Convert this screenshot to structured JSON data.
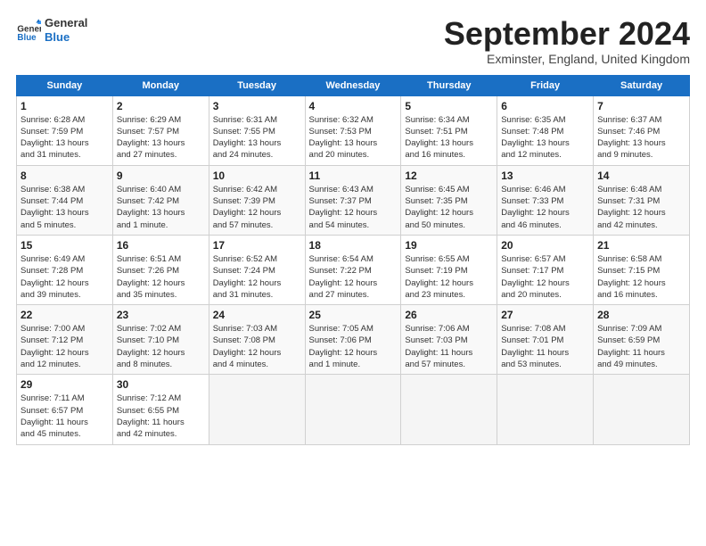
{
  "header": {
    "logo_line1": "General",
    "logo_line2": "Blue",
    "month": "September 2024",
    "location": "Exminster, England, United Kingdom"
  },
  "days_of_week": [
    "Sunday",
    "Monday",
    "Tuesday",
    "Wednesday",
    "Thursday",
    "Friday",
    "Saturday"
  ],
  "weeks": [
    [
      {
        "day": "1",
        "info": "Sunrise: 6:28 AM\nSunset: 7:59 PM\nDaylight: 13 hours\nand 31 minutes."
      },
      {
        "day": "2",
        "info": "Sunrise: 6:29 AM\nSunset: 7:57 PM\nDaylight: 13 hours\nand 27 minutes."
      },
      {
        "day": "3",
        "info": "Sunrise: 6:31 AM\nSunset: 7:55 PM\nDaylight: 13 hours\nand 24 minutes."
      },
      {
        "day": "4",
        "info": "Sunrise: 6:32 AM\nSunset: 7:53 PM\nDaylight: 13 hours\nand 20 minutes."
      },
      {
        "day": "5",
        "info": "Sunrise: 6:34 AM\nSunset: 7:51 PM\nDaylight: 13 hours\nand 16 minutes."
      },
      {
        "day": "6",
        "info": "Sunrise: 6:35 AM\nSunset: 7:48 PM\nDaylight: 13 hours\nand 12 minutes."
      },
      {
        "day": "7",
        "info": "Sunrise: 6:37 AM\nSunset: 7:46 PM\nDaylight: 13 hours\nand 9 minutes."
      }
    ],
    [
      {
        "day": "8",
        "info": "Sunrise: 6:38 AM\nSunset: 7:44 PM\nDaylight: 13 hours\nand 5 minutes."
      },
      {
        "day": "9",
        "info": "Sunrise: 6:40 AM\nSunset: 7:42 PM\nDaylight: 13 hours\nand 1 minute."
      },
      {
        "day": "10",
        "info": "Sunrise: 6:42 AM\nSunset: 7:39 PM\nDaylight: 12 hours\nand 57 minutes."
      },
      {
        "day": "11",
        "info": "Sunrise: 6:43 AM\nSunset: 7:37 PM\nDaylight: 12 hours\nand 54 minutes."
      },
      {
        "day": "12",
        "info": "Sunrise: 6:45 AM\nSunset: 7:35 PM\nDaylight: 12 hours\nand 50 minutes."
      },
      {
        "day": "13",
        "info": "Sunrise: 6:46 AM\nSunset: 7:33 PM\nDaylight: 12 hours\nand 46 minutes."
      },
      {
        "day": "14",
        "info": "Sunrise: 6:48 AM\nSunset: 7:31 PM\nDaylight: 12 hours\nand 42 minutes."
      }
    ],
    [
      {
        "day": "15",
        "info": "Sunrise: 6:49 AM\nSunset: 7:28 PM\nDaylight: 12 hours\nand 39 minutes."
      },
      {
        "day": "16",
        "info": "Sunrise: 6:51 AM\nSunset: 7:26 PM\nDaylight: 12 hours\nand 35 minutes."
      },
      {
        "day": "17",
        "info": "Sunrise: 6:52 AM\nSunset: 7:24 PM\nDaylight: 12 hours\nand 31 minutes."
      },
      {
        "day": "18",
        "info": "Sunrise: 6:54 AM\nSunset: 7:22 PM\nDaylight: 12 hours\nand 27 minutes."
      },
      {
        "day": "19",
        "info": "Sunrise: 6:55 AM\nSunset: 7:19 PM\nDaylight: 12 hours\nand 23 minutes."
      },
      {
        "day": "20",
        "info": "Sunrise: 6:57 AM\nSunset: 7:17 PM\nDaylight: 12 hours\nand 20 minutes."
      },
      {
        "day": "21",
        "info": "Sunrise: 6:58 AM\nSunset: 7:15 PM\nDaylight: 12 hours\nand 16 minutes."
      }
    ],
    [
      {
        "day": "22",
        "info": "Sunrise: 7:00 AM\nSunset: 7:12 PM\nDaylight: 12 hours\nand 12 minutes."
      },
      {
        "day": "23",
        "info": "Sunrise: 7:02 AM\nSunset: 7:10 PM\nDaylight: 12 hours\nand 8 minutes."
      },
      {
        "day": "24",
        "info": "Sunrise: 7:03 AM\nSunset: 7:08 PM\nDaylight: 12 hours\nand 4 minutes."
      },
      {
        "day": "25",
        "info": "Sunrise: 7:05 AM\nSunset: 7:06 PM\nDaylight: 12 hours\nand 1 minute."
      },
      {
        "day": "26",
        "info": "Sunrise: 7:06 AM\nSunset: 7:03 PM\nDaylight: 11 hours\nand 57 minutes."
      },
      {
        "day": "27",
        "info": "Sunrise: 7:08 AM\nSunset: 7:01 PM\nDaylight: 11 hours\nand 53 minutes."
      },
      {
        "day": "28",
        "info": "Sunrise: 7:09 AM\nSunset: 6:59 PM\nDaylight: 11 hours\nand 49 minutes."
      }
    ],
    [
      {
        "day": "29",
        "info": "Sunrise: 7:11 AM\nSunset: 6:57 PM\nDaylight: 11 hours\nand 45 minutes."
      },
      {
        "day": "30",
        "info": "Sunrise: 7:12 AM\nSunset: 6:55 PM\nDaylight: 11 hours\nand 42 minutes."
      },
      {
        "day": "",
        "info": ""
      },
      {
        "day": "",
        "info": ""
      },
      {
        "day": "",
        "info": ""
      },
      {
        "day": "",
        "info": ""
      },
      {
        "day": "",
        "info": ""
      }
    ]
  ]
}
